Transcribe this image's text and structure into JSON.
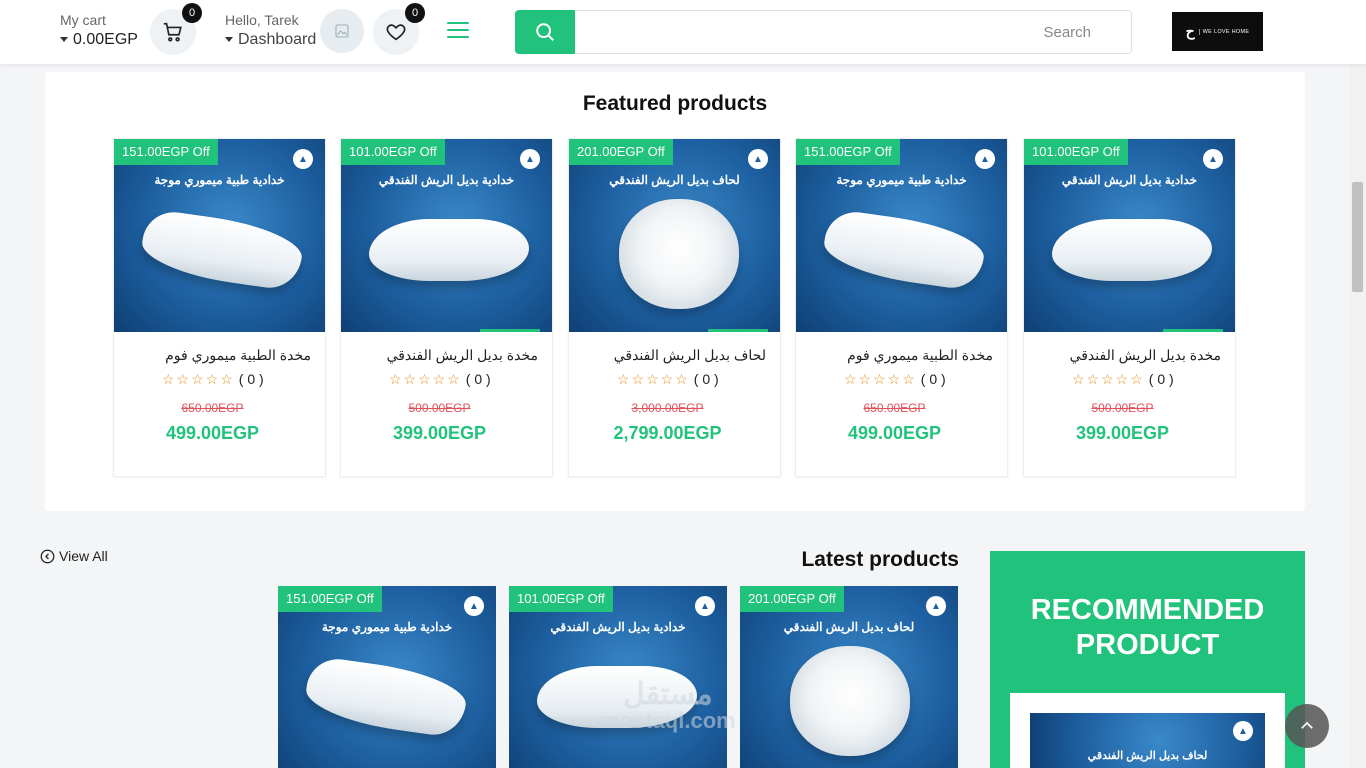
{
  "header": {
    "cart": {
      "label": "My cart",
      "value": "0.00EGP",
      "count": "0"
    },
    "user": {
      "hello": "Hello, Tarek",
      "menu": "Dashboard"
    },
    "wishlist_count": "0",
    "search": {
      "placeholder": "Search"
    },
    "logo": {
      "mark": "ح",
      "text": "WE LOVE HOME"
    }
  },
  "featured": {
    "title": "Featured products",
    "products": [
      {
        "badge": "151.00EGP Off",
        "caption": "خدادية طبية ميموري موجة",
        "name": "مخدة الطبية ميموري فوم",
        "rating": "( 0 )",
        "old_price": "650.00EGP",
        "price": "499.00EGP",
        "kind": "memory"
      },
      {
        "badge": "101.00EGP Off",
        "caption": "خدادية بديل الريش الفندقي",
        "name": "مخدة بديل الريش الفندقي",
        "rating": "( 0 )",
        "old_price": "500.00EGP",
        "price": "399.00EGP",
        "kind": "feather"
      },
      {
        "badge": "201.00EGP Off",
        "caption": "لحاف بديل الريش الفندقي",
        "name": "لحاف بديل الريش الفندقي",
        "rating": "( 0 )",
        "old_price": "3,000.00EGP",
        "price": "2,799.00EGP",
        "kind": "duvet"
      },
      {
        "badge": "151.00EGP Off",
        "caption": "خدادية طبية ميموري موجة",
        "name": "مخدة الطبية ميموري فوم",
        "rating": "( 0 )",
        "old_price": "650.00EGP",
        "price": "499.00EGP",
        "kind": "memory"
      },
      {
        "badge": "101.00EGP Off",
        "caption": "خدادية بديل الريش الفندقي",
        "name": "مخدة بديل الريش الفندقي",
        "rating": "( 0 )",
        "old_price": "500.00EGP",
        "price": "399.00EGP",
        "kind": "feather"
      }
    ]
  },
  "latest": {
    "title": "Latest products",
    "view_all": "View All",
    "products": [
      {
        "badge": "151.00EGP Off",
        "caption": "خدادية طبية ميموري موجة",
        "kind": "memory"
      },
      {
        "badge": "101.00EGP Off",
        "caption": "خدادية بديل الريش الفندقي",
        "kind": "feather"
      },
      {
        "badge": "201.00EGP Off",
        "caption": "لحاف بديل الريش الفندقي",
        "kind": "duvet"
      }
    ]
  },
  "recommended": {
    "title": "RECOMMENDED PRODUCT",
    "caption": "لحاف بديل الريش الفندقي"
  },
  "watermark": {
    "main": "مستقل",
    "sub": "mostaql.com"
  },
  "colors": {
    "accent": "#21c37c",
    "sale": "#e0505a",
    "star": "#e8901c"
  }
}
